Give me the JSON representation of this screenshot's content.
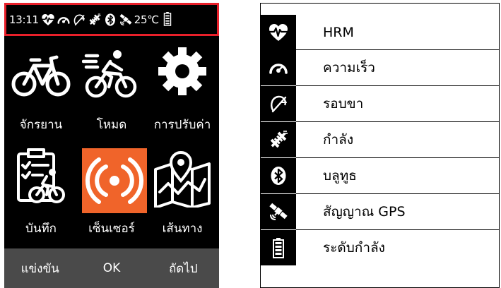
{
  "status_bar": {
    "time": "13:11",
    "temperature": "25℃",
    "icons": [
      "heart-rate-icon",
      "speedometer-icon",
      "cadence-icon",
      "power-meter-icon",
      "bluetooth-icon",
      "gps-satellite-icon",
      "battery-icon"
    ]
  },
  "menu": {
    "tiles": [
      {
        "label": "จักรยาน",
        "icon": "bicycle-icon"
      },
      {
        "label": "โหมด",
        "icon": "cyclist-icon"
      },
      {
        "label": "การปรับค่า",
        "icon": "gear-icon"
      },
      {
        "label": "บันทึก",
        "icon": "clipboard-cyclist-icon"
      },
      {
        "label": "เซ็นเซอร์",
        "icon": "sensor-broadcast-icon",
        "selected": true
      },
      {
        "label": "เส้นทาง",
        "icon": "route-map-icon"
      }
    ],
    "selected_color": "#f0642a"
  },
  "softkeys": {
    "left": "แข่งขัน",
    "center": "OK",
    "right": "ถัดไป"
  },
  "legend": {
    "items": [
      {
        "icon": "heart-rate-icon",
        "label": "HRM"
      },
      {
        "icon": "speedometer-icon",
        "label": "ความเร็ว"
      },
      {
        "icon": "cadence-icon",
        "label": "รอบขา"
      },
      {
        "icon": "power-meter-icon",
        "label": "กำลัง"
      },
      {
        "icon": "bluetooth-icon",
        "label": "บลูทูธ"
      },
      {
        "icon": "gps-satellite-icon",
        "label": "สัญญาณ GPS"
      },
      {
        "icon": "battery-icon",
        "label": "ระดับกำลัง"
      }
    ]
  },
  "colors": {
    "highlight_border": "#e8202a",
    "softkey_bar": "#4a4a4a",
    "screen_background": "#000000"
  }
}
